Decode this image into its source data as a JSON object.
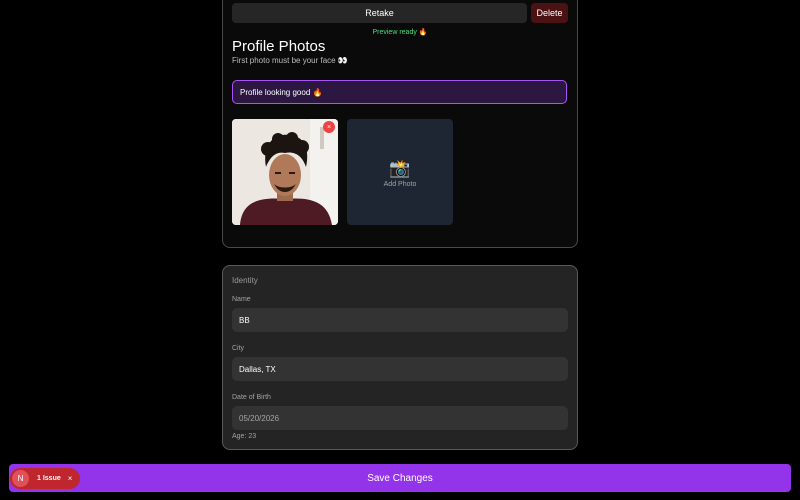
{
  "photo_controls": {
    "retake_label": "Retake",
    "delete_label": "Delete",
    "preview_status": "Preview ready 🔥"
  },
  "profile_photos": {
    "title": "Profile Photos",
    "subtitle": "First photo must be your face 👀",
    "banner": "Profile looking good 🔥",
    "remove_icon": "×",
    "add_photo_icon": "📸",
    "add_photo_label": "Add Photo"
  },
  "identity": {
    "title": "Identity",
    "name_label": "Name",
    "name_value": "BB",
    "city_label": "City",
    "city_value": "Dallas, TX",
    "dob_label": "Date of Birth",
    "dob_value": "05/20/2026",
    "age_text": "Age: 23"
  },
  "footer": {
    "save_label": "Save Changes",
    "issue_logo": "N",
    "issue_label": "1 Issue",
    "issue_close": "×"
  },
  "colors": {
    "accent": "#9333ea",
    "banner_border": "#a855f7",
    "success": "#4ade80",
    "danger": "#ef4444",
    "issue_badge": "#c0262d"
  }
}
